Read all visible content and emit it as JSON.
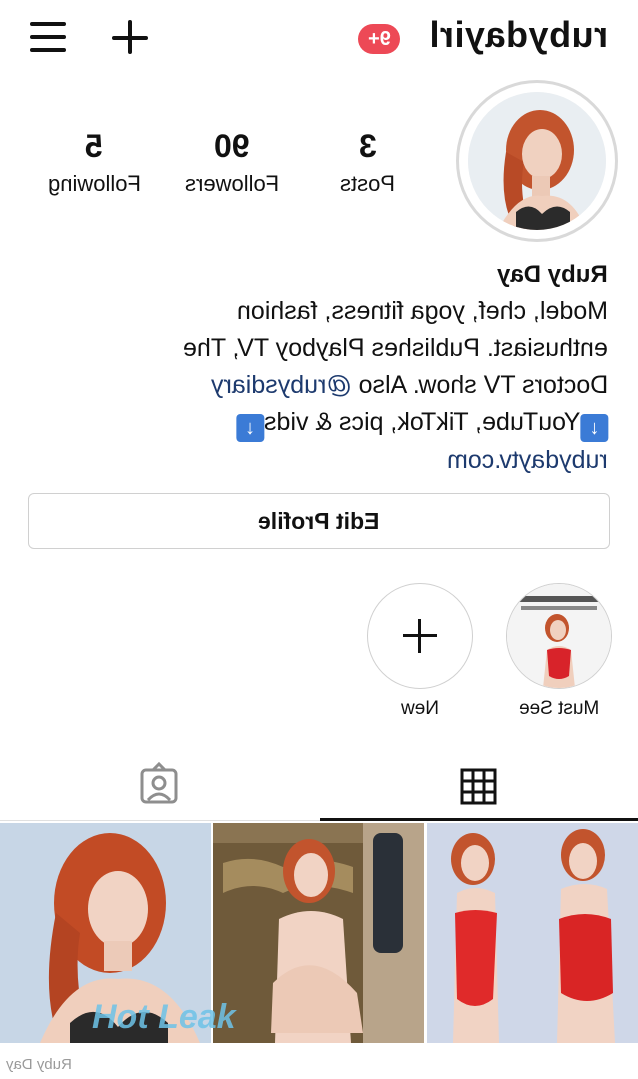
{
  "header": {
    "username": "rubydayirl",
    "notifications": "9+",
    "menu_icon": "hamburger-menu-icon",
    "create_icon": "plus-icon"
  },
  "stats": {
    "posts": {
      "count": "3",
      "label": "Posts"
    },
    "followers": {
      "count": "90",
      "label": "Followers"
    },
    "following": {
      "count": "5",
      "label": "Following"
    }
  },
  "bio": {
    "name": "Ruby Day",
    "line1": "Model, chef, yoga fitness, fashion",
    "line2": "enthusiast.  Publishes Playboy TV, The",
    "line3_text": "Doctors TV show.  Also ",
    "line3_link": "@rubysdiary",
    "line4": "YouTube, TikTok, pics & vids",
    "website": "rubydaytv.com"
  },
  "actions": {
    "edit_profile": "Edit Profile"
  },
  "highlights": [
    {
      "label": "Must See"
    },
    {
      "label": "New"
    }
  ],
  "watermark": {
    "text": "Ruby Day",
    "brand": "Hot Leak"
  },
  "colors": {
    "badge": "#ed4956",
    "link": "#1d3a6e"
  }
}
